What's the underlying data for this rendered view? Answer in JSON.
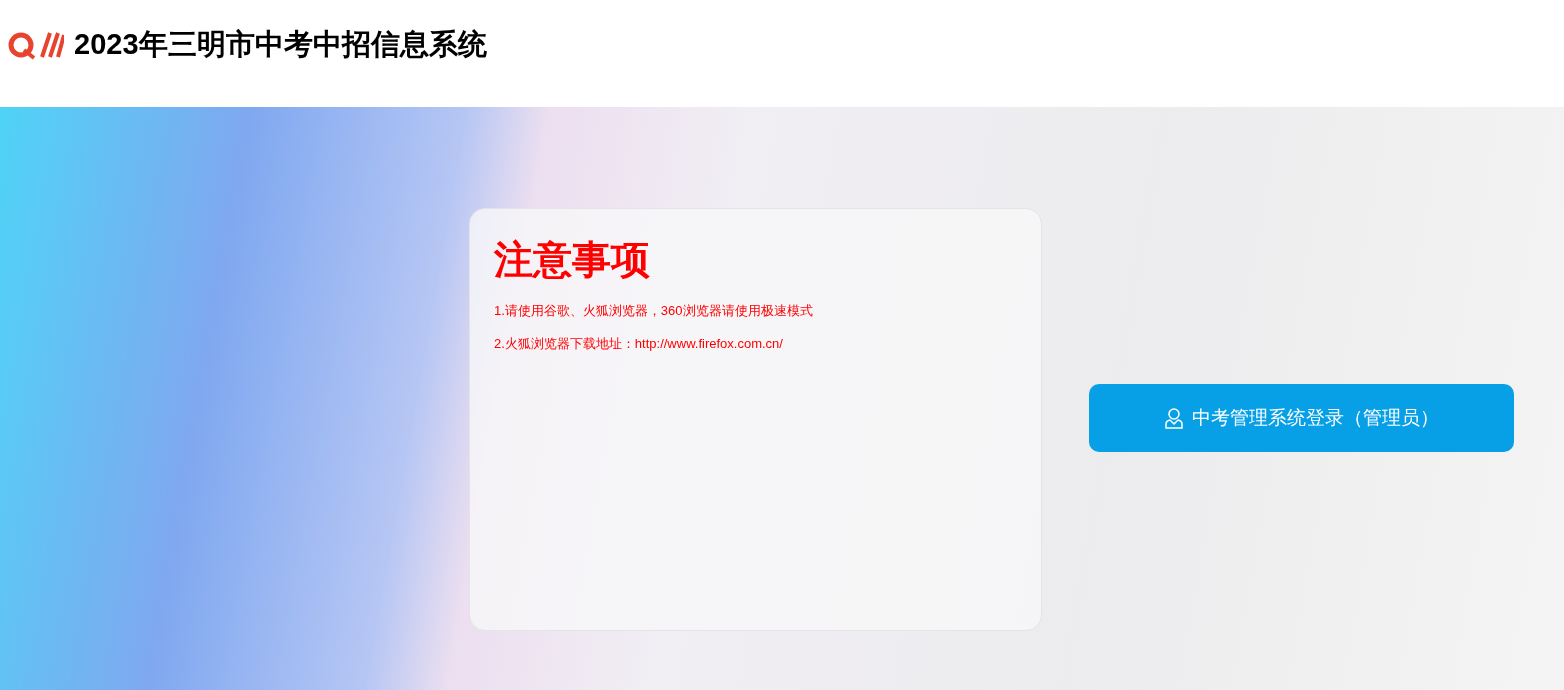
{
  "header": {
    "title": "2023年三明市中考中招信息系统"
  },
  "notice": {
    "title": "注意事项",
    "lines": [
      "1.请使用谷歌、火狐浏览器，360浏览器请使用极速模式",
      "2.火狐浏览器下载地址：http://www.firefox.com.cn/"
    ]
  },
  "login_button": {
    "label": "中考管理系统登录（管理员）"
  }
}
